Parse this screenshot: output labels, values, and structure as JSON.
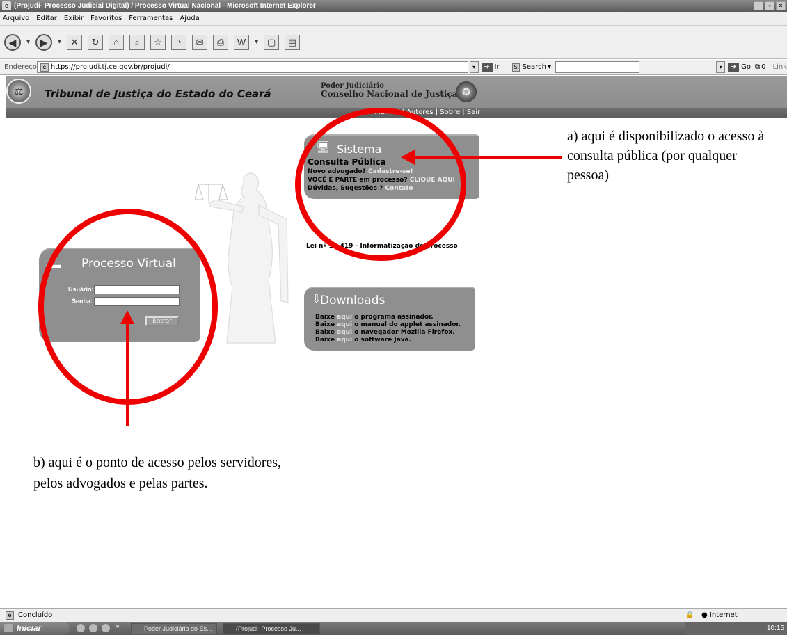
{
  "window": {
    "title": "(Projudi- Processo Judicial Digital) / Processo Virtual Nacional - Microsoft Internet Explorer"
  },
  "menu": [
    "Arquivo",
    "Editar",
    "Exibir",
    "Favoritos",
    "Ferramentas",
    "Ajuda"
  ],
  "address": {
    "label": "Endereço",
    "url": "https://projudi.tj.ce.gov.br/projudi/",
    "go_label": "Ir",
    "search_label": "Search",
    "go2_label": "Go",
    "counter": "0",
    "links_label": "Link"
  },
  "header": {
    "court_name": "Tribunal de Justiça do Estado do Ceará",
    "poder": "Poder Judiciário",
    "conselho": "Conselho Nacional de Justiça",
    "nav_links": "Manual | Autores | Sobre | Sair"
  },
  "sistema": {
    "title": "Sistema",
    "consulta": "Consulta Pública",
    "line1_text": "Novo advogado?",
    "line1_link": "Cadastre-se!",
    "line2_text": "VOCÊ É PARTE em processo?",
    "line2_link": "CLIQUE AQUI",
    "line3_text": "Dúvidas, Sugestões ?",
    "line3_link": "Contato"
  },
  "lei": "Lei nº 11.419 - Informatização do processo",
  "downloads": {
    "title": "Downloads",
    "items": [
      {
        "pre": "Baixe",
        "link": "aqui",
        "post": "o programa assinador."
      },
      {
        "pre": "Baixe",
        "link": "aqui",
        "post": "o manual do applet assinador."
      },
      {
        "pre": "Baixe",
        "link": "aqui",
        "post": "o navegador Mozilla Firefox."
      },
      {
        "pre": "Baixe",
        "link": "aqui",
        "post": "o software Java."
      }
    ]
  },
  "processo_virtual": {
    "title": "Processo Virtual",
    "user_label": "Usuário:",
    "pass_label": "Senha:",
    "enter_label": "Entrar",
    "user_value": "",
    "pass_value": ""
  },
  "annotations": {
    "a": "a) aqui é disponibilizado o acesso à consulta pública (por qualquer pessoa)",
    "b": "b) aqui é o ponto de acesso pelos servidores, pelos advogados e pelas partes."
  },
  "status": {
    "text": "Concluído",
    "zone": "Internet"
  },
  "taskbar": {
    "start": "Iniciar",
    "tasks": [
      "Poder Judiciário do Es...",
      "(Projudi- Processo Ju..."
    ],
    "clock": "10:15"
  },
  "colors": {
    "annotation_red": "#ee0000",
    "panel_gray": "#8f8f8f"
  }
}
